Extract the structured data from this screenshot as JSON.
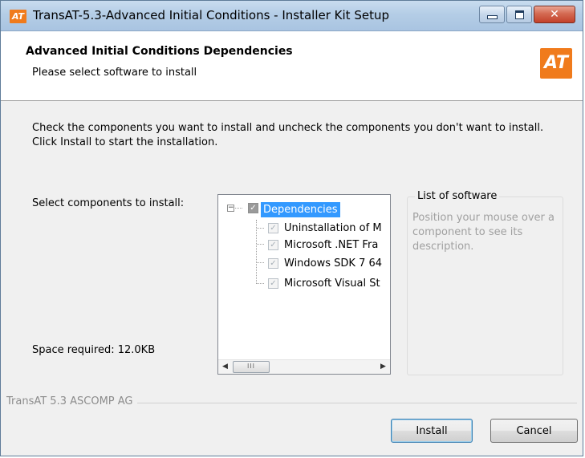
{
  "window": {
    "title": "TransAT-5.3-Advanced Initial Conditions - Installer Kit Setup",
    "app_icon_text": "AT",
    "close_glyph": "✕"
  },
  "header": {
    "title": "Advanced Initial Conditions Dependencies",
    "subtitle": "Please select software to install",
    "logo_text": "AT"
  },
  "body": {
    "instructions": "Check the components you want to install and uncheck the components you don't want to install. Click Install to start the installation.",
    "select_label": "Select components to install:",
    "space_required": "Space required: 12.0KB"
  },
  "tree": {
    "root": {
      "label": "Dependencies",
      "expander": "−",
      "checked": true
    },
    "items": [
      {
        "label": "Uninstallation of M",
        "checked": true
      },
      {
        "label": "Microsoft .NET Fra",
        "checked": true
      },
      {
        "label": "Windows SDK 7 64",
        "checked": true
      },
      {
        "label": "Microsoft Visual St",
        "checked": true
      }
    ],
    "scroll_left": "◀",
    "scroll_right": "▶",
    "scroll_grip": "III"
  },
  "description_box": {
    "title": "List of software",
    "text": "Position your mouse over a component to see its description."
  },
  "footer": {
    "brand": "TransAT 5.3 ASCOMP AG",
    "install_label": "Install",
    "cancel_label": "Cancel"
  }
}
